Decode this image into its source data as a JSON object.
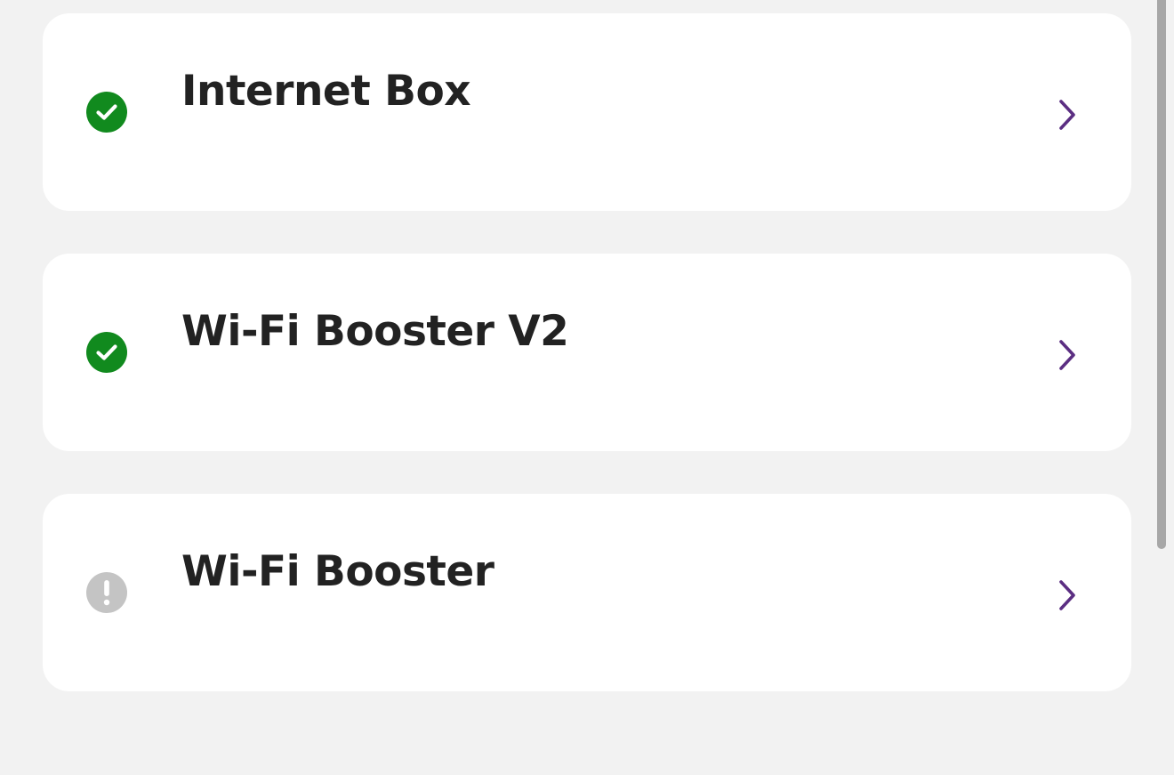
{
  "devices": [
    {
      "name": "Internet Box",
      "status": "ok",
      "status_icon": "check-circle-icon",
      "status_color": "#118a1e"
    },
    {
      "name": "Wi-Fi Booster V2",
      "status": "ok",
      "status_icon": "check-circle-icon",
      "status_color": "#118a1e"
    },
    {
      "name": "Wi-Fi Booster",
      "status": "warning",
      "status_icon": "exclamation-circle-icon",
      "status_color": "#c4c4c4"
    }
  ],
  "chevron_icon": "chevron-right-icon",
  "colors": {
    "background": "#f2f2f2",
    "card": "#ffffff",
    "text": "#222222",
    "chevron": "#5b2e82",
    "scrollbar": "#a7a7a7"
  }
}
